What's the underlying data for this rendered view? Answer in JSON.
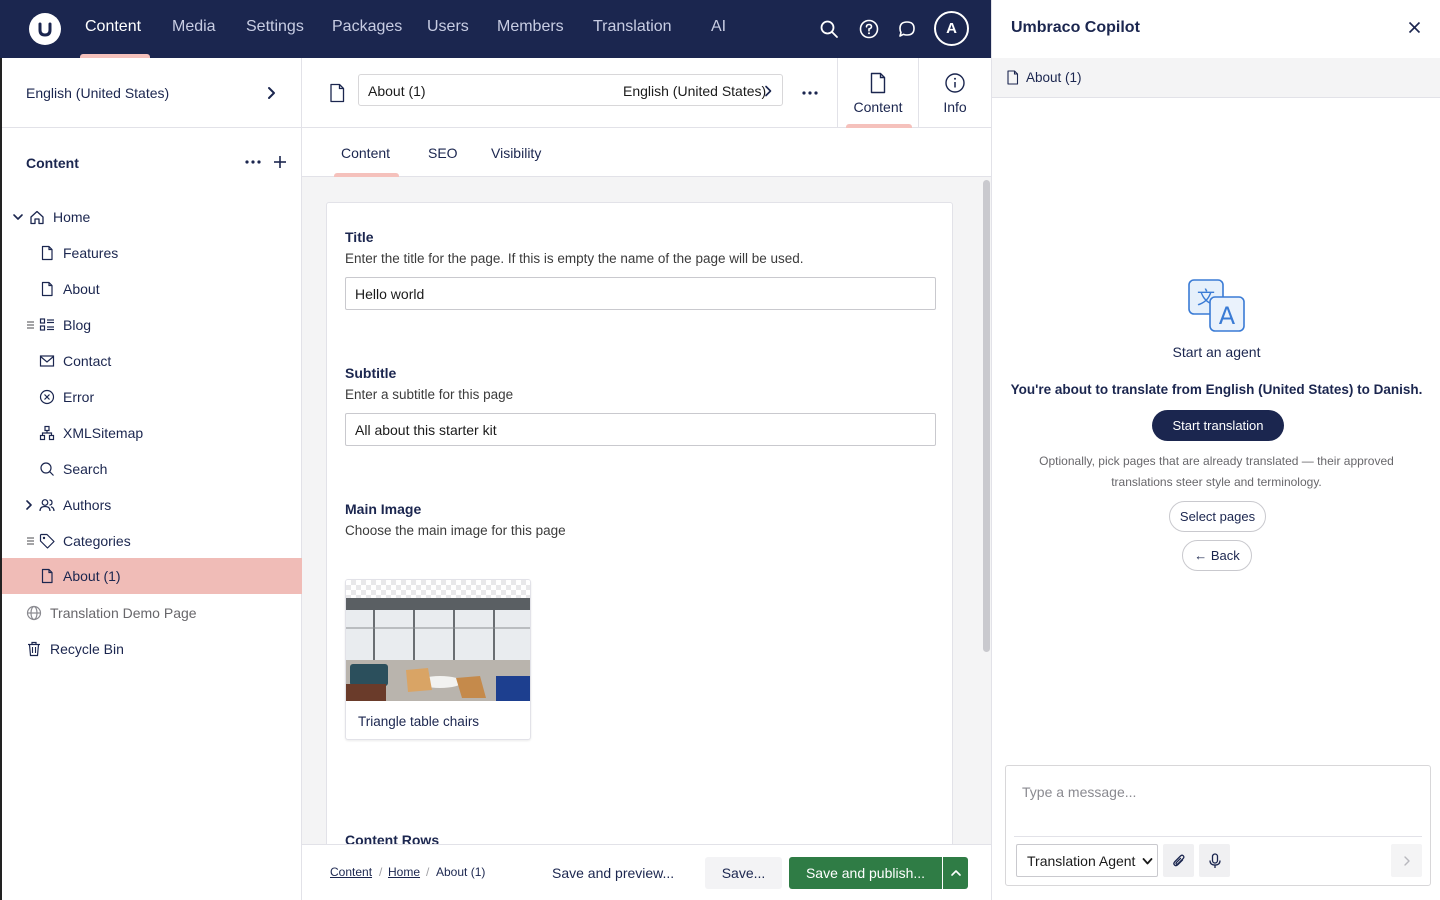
{
  "topnav": {
    "items": [
      "Content",
      "Media",
      "Settings",
      "Packages",
      "Users",
      "Members",
      "Translation",
      "AI"
    ],
    "active": "Content",
    "avatar_initial": "A"
  },
  "sidebar": {
    "language": "English (United States)",
    "section_title": "Content",
    "tree": [
      {
        "label": "Home",
        "icon": "home-icon"
      },
      {
        "label": "Features",
        "icon": "document-icon"
      },
      {
        "label": "About",
        "icon": "document-icon"
      },
      {
        "label": "Blog",
        "icon": "list-icon"
      },
      {
        "label": "Contact",
        "icon": "mail-icon"
      },
      {
        "label": "Error",
        "icon": "error-icon"
      },
      {
        "label": "XMLSitemap",
        "icon": "sitemap-icon"
      },
      {
        "label": "Search",
        "icon": "search-icon"
      },
      {
        "label": "Authors",
        "icon": "users-icon"
      },
      {
        "label": "Categories",
        "icon": "tag-icon"
      },
      {
        "label": "About (1)",
        "icon": "document-icon"
      },
      {
        "label": "Translation Demo Page",
        "icon": "globe-icon"
      },
      {
        "label": "Recycle Bin",
        "icon": "trash-icon"
      }
    ]
  },
  "workspace": {
    "document_name": "About (1)",
    "document_language": "English (United States)",
    "views": {
      "content": "Content",
      "info": "Info"
    },
    "tabs": [
      "Content",
      "SEO",
      "Visibility"
    ],
    "properties": {
      "title": {
        "label": "Title",
        "description": "Enter the title for the page. If this is empty the name of the page will be used.",
        "value": "Hello world"
      },
      "subtitle": {
        "label": "Subtitle",
        "description": "Enter a subtitle for this page",
        "value": "All about this starter kit"
      },
      "main_image": {
        "label": "Main Image",
        "description": "Choose the main image for this page",
        "media_name": "Triangle table chairs"
      },
      "content_rows": {
        "label": "Content Rows"
      }
    }
  },
  "footer": {
    "breadcrumb": [
      "Content",
      "Home",
      "About (1)"
    ],
    "save_preview": "Save and preview...",
    "save": "Save...",
    "save_publish": "Save and publish...",
    "publish_color": "#2f7c45"
  },
  "copilot": {
    "title": "Umbraco Copilot",
    "context_document": "About (1)",
    "start_agent": "Start an agent",
    "translate_message": "You're about to translate from English (United States) to Danish.",
    "start_button": "Start translation",
    "hint_line1": "Optionally, pick pages that are already translated — their approved",
    "hint_line2": "translations steer style and terminology.",
    "select_pages": "Select pages",
    "back": "← Back",
    "message_placeholder": "Type a message...",
    "agent": "Translation Agent"
  },
  "colors": {
    "nav_bg": "#1b264f",
    "accent": "#f5c1bc",
    "selected_bg": "#f0bcb7"
  }
}
